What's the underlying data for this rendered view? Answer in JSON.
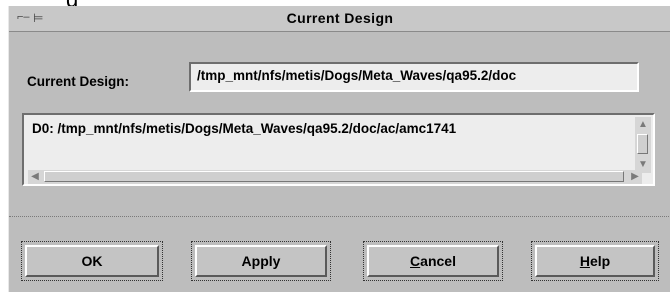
{
  "window": {
    "title": "Current Design"
  },
  "field": {
    "label": "Current Design:",
    "value": "/tmp_mnt/nfs/metis/Dogs/Meta_Waves/qa95.2/doc"
  },
  "list": {
    "items": [
      "D0: /tmp_mnt/nfs/metis/Dogs/Meta_Waves/qa95.2/doc/ac/amc1741"
    ]
  },
  "buttons": {
    "ok": "OK",
    "apply": "Apply",
    "cancel_mnemonic": "C",
    "cancel_rest": "ancel",
    "help_mnemonic": "H",
    "help_rest": "elp"
  },
  "icons": [
    "window-menu-icon",
    "pin-icon",
    "scroll-up-icon",
    "scroll-down-icon",
    "scroll-left-icon",
    "scroll-right-icon"
  ]
}
